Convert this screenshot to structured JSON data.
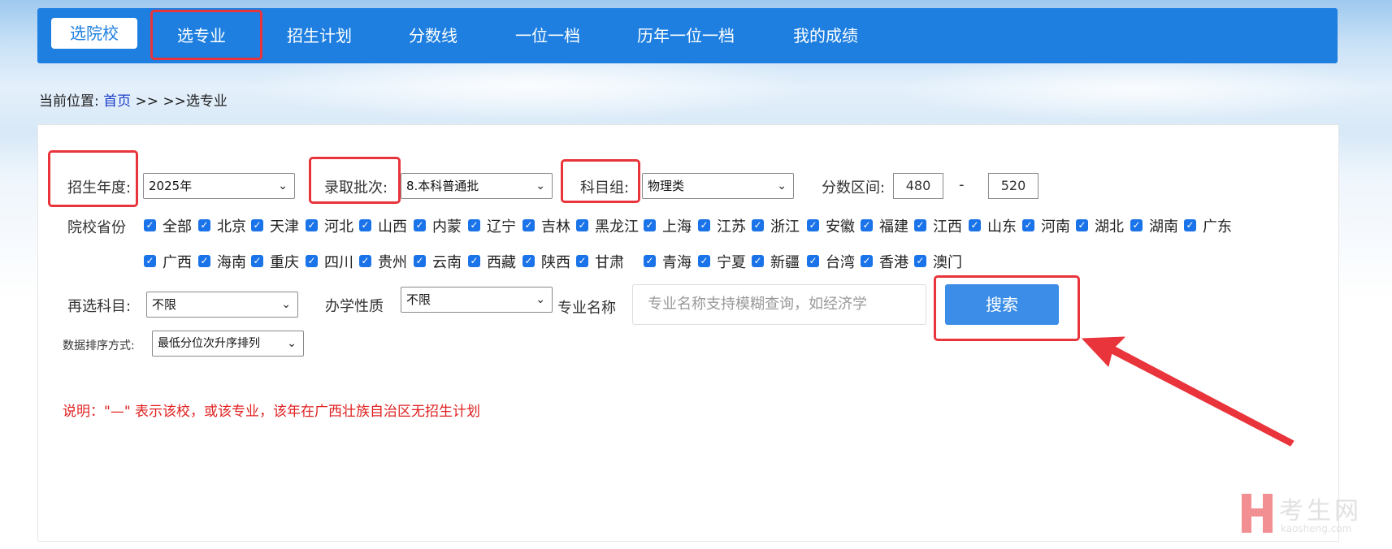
{
  "nav": {
    "items": [
      "选院校",
      "选专业",
      "招生计划",
      "分数线",
      "一位一档",
      "历年一位一档",
      "我的成绩"
    ]
  },
  "breadcrumb": {
    "prefix": "当前位置:",
    "home": "首页",
    "sep": ">> >>",
    "current": "选专业"
  },
  "filters": {
    "year_label": "招生年度:",
    "year_value": "2025年",
    "batch_label": "录取批次:",
    "batch_value": "8.本科普通批",
    "subject_label": "科目组:",
    "subject_value": "物理类",
    "score_label": "分数区间:",
    "score_min": "480",
    "score_dash": "-",
    "score_max": "520",
    "province_label": "院校省份",
    "provinces": [
      "全部",
      "北京",
      "天津",
      "河北",
      "山西",
      "内蒙",
      "辽宁",
      "吉林",
      "黑龙江",
      "上海",
      "江苏",
      "浙江",
      "安徽",
      "福建",
      "江西",
      "山东",
      "河南",
      "湖北",
      "湖南",
      "广东",
      "广西",
      "海南",
      "重庆",
      "四川",
      "贵州",
      "云南",
      "西藏",
      "陕西",
      "甘肃",
      "青海",
      "宁夏",
      "新疆",
      "台湾",
      "香港",
      "澳门"
    ],
    "reselect_label": "再选科目:",
    "reselect_value": "不限",
    "nature_label": "办学性质",
    "nature_value": "不限",
    "major_label": "专业名称",
    "major_placeholder": "专业名称支持模糊查询，如经济学",
    "search_label": "搜索",
    "sort_label": "数据排序方式:",
    "sort_value": "最低分位次升序排列"
  },
  "note": "说明：\"—\" 表示该校，或该专业，该年在广西壮族自治区无招生计划",
  "watermark": {
    "cn": "考生网",
    "en": "kaosheng.com"
  },
  "colors": {
    "nav": "#1e7fe0",
    "highlight": "#e8343a",
    "button": "#3b8de8",
    "note": "#e02020"
  }
}
